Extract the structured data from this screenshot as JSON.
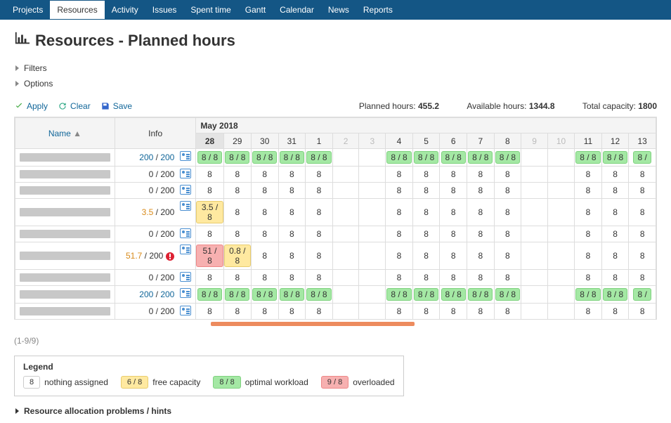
{
  "nav": {
    "items": [
      {
        "label": "Projects",
        "active": false
      },
      {
        "label": "Resources",
        "active": true
      },
      {
        "label": "Activity",
        "active": false
      },
      {
        "label": "Issues",
        "active": false
      },
      {
        "label": "Spent time",
        "active": false
      },
      {
        "label": "Gantt",
        "active": false
      },
      {
        "label": "Calendar",
        "active": false
      },
      {
        "label": "News",
        "active": false
      },
      {
        "label": "Reports",
        "active": false
      }
    ]
  },
  "page": {
    "title": "Resources - Planned hours",
    "filters_label": "Filters",
    "options_label": "Options"
  },
  "actions": {
    "apply": "Apply",
    "clear": "Clear",
    "save": "Save"
  },
  "summary": {
    "planned_label": "Planned hours:",
    "planned_value": "455.2",
    "available_label": "Available hours:",
    "available_value": "1344.8",
    "capacity_label": "Total capacity:",
    "capacity_value": "1800"
  },
  "table": {
    "headers": {
      "name": "Name",
      "info": "Info"
    },
    "month": "May 2018",
    "days": [
      {
        "n": "28",
        "today": true,
        "weekend": false
      },
      {
        "n": "29",
        "today": false,
        "weekend": false
      },
      {
        "n": "30",
        "today": false,
        "weekend": false
      },
      {
        "n": "31",
        "today": false,
        "weekend": false
      },
      {
        "n": "1",
        "today": false,
        "weekend": false
      },
      {
        "n": "2",
        "today": false,
        "weekend": true
      },
      {
        "n": "3",
        "today": false,
        "weekend": true
      },
      {
        "n": "4",
        "today": false,
        "weekend": false
      },
      {
        "n": "5",
        "today": false,
        "weekend": false
      },
      {
        "n": "6",
        "today": false,
        "weekend": false
      },
      {
        "n": "7",
        "today": false,
        "weekend": false
      },
      {
        "n": "8",
        "today": false,
        "weekend": false
      },
      {
        "n": "9",
        "today": false,
        "weekend": true
      },
      {
        "n": "10",
        "today": false,
        "weekend": true
      },
      {
        "n": "11",
        "today": false,
        "weekend": false
      },
      {
        "n": "12",
        "today": false,
        "weekend": false
      },
      {
        "n": "13",
        "today": false,
        "weekend": false
      }
    ],
    "rows": [
      {
        "info_html": [
          "200",
          " / ",
          "200"
        ],
        "info_style": "blue",
        "over": false,
        "cells": [
          "8 / 8",
          "8 / 8",
          "8 / 8",
          "8 / 8",
          "8 / 8",
          "",
          "",
          "8 / 8",
          "8 / 8",
          "8 / 8",
          "8 / 8",
          "8 / 8",
          "",
          "",
          "8 / 8",
          "8 / 8",
          "8 /"
        ],
        "types": [
          "opt",
          "opt",
          "opt",
          "opt",
          "opt",
          "",
          "",
          "opt",
          "opt",
          "opt",
          "opt",
          "opt",
          "",
          "",
          "opt",
          "opt",
          "opt"
        ]
      },
      {
        "info_html": [
          "0 / 200"
        ],
        "info_style": "",
        "over": false,
        "cells": [
          "8",
          "8",
          "8",
          "8",
          "8",
          "",
          "",
          "8",
          "8",
          "8",
          "8",
          "8",
          "",
          "",
          "8",
          "8",
          "8"
        ],
        "types": [
          "none",
          "none",
          "none",
          "none",
          "none",
          "",
          "",
          "none",
          "none",
          "none",
          "none",
          "none",
          "",
          "",
          "none",
          "none",
          "none"
        ]
      },
      {
        "info_html": [
          "0 / 200"
        ],
        "info_style": "",
        "over": false,
        "cells": [
          "8",
          "8",
          "8",
          "8",
          "8",
          "",
          "",
          "8",
          "8",
          "8",
          "8",
          "8",
          "",
          "",
          "8",
          "8",
          "8"
        ],
        "types": [
          "none",
          "none",
          "none",
          "none",
          "none",
          "",
          "",
          "none",
          "none",
          "none",
          "none",
          "none",
          "",
          "",
          "none",
          "none",
          "none"
        ]
      },
      {
        "info_html": [
          "3.5",
          " / 200"
        ],
        "info_style": "orange",
        "over": false,
        "cells": [
          "3.5 / 8",
          "8",
          "8",
          "8",
          "8",
          "",
          "",
          "8",
          "8",
          "8",
          "8",
          "8",
          "",
          "",
          "8",
          "8",
          "8"
        ],
        "types": [
          "free",
          "none",
          "none",
          "none",
          "none",
          "",
          "",
          "none",
          "none",
          "none",
          "none",
          "none",
          "",
          "",
          "none",
          "none",
          "none"
        ]
      },
      {
        "info_html": [
          "0 / 200"
        ],
        "info_style": "",
        "over": false,
        "cells": [
          "8",
          "8",
          "8",
          "8",
          "8",
          "",
          "",
          "8",
          "8",
          "8",
          "8",
          "8",
          "",
          "",
          "8",
          "8",
          "8"
        ],
        "types": [
          "none",
          "none",
          "none",
          "none",
          "none",
          "",
          "",
          "none",
          "none",
          "none",
          "none",
          "none",
          "",
          "",
          "none",
          "none",
          "none"
        ]
      },
      {
        "info_html": [
          "51.7",
          " / 200"
        ],
        "info_style": "orange",
        "over": true,
        "cells": [
          "51 / 8",
          "0.8 / 8",
          "8",
          "8",
          "8",
          "",
          "",
          "8",
          "8",
          "8",
          "8",
          "8",
          "",
          "",
          "8",
          "8",
          "8"
        ],
        "types": [
          "over",
          "free",
          "none",
          "none",
          "none",
          "",
          "",
          "none",
          "none",
          "none",
          "none",
          "none",
          "",
          "",
          "none",
          "none",
          "none"
        ]
      },
      {
        "info_html": [
          "0 / 200"
        ],
        "info_style": "",
        "over": false,
        "cells": [
          "8",
          "8",
          "8",
          "8",
          "8",
          "",
          "",
          "8",
          "8",
          "8",
          "8",
          "8",
          "",
          "",
          "8",
          "8",
          "8"
        ],
        "types": [
          "none",
          "none",
          "none",
          "none",
          "none",
          "",
          "",
          "none",
          "none",
          "none",
          "none",
          "none",
          "",
          "",
          "none",
          "none",
          "none"
        ]
      },
      {
        "info_html": [
          "200",
          " / ",
          "200"
        ],
        "info_style": "blue",
        "over": false,
        "cells": [
          "8 / 8",
          "8 / 8",
          "8 / 8",
          "8 / 8",
          "8 / 8",
          "",
          "",
          "8 / 8",
          "8 / 8",
          "8 / 8",
          "8 / 8",
          "8 / 8",
          "",
          "",
          "8 / 8",
          "8 / 8",
          "8 /"
        ],
        "types": [
          "opt",
          "opt",
          "opt",
          "opt",
          "opt",
          "",
          "",
          "opt",
          "opt",
          "opt",
          "opt",
          "opt",
          "",
          "",
          "opt",
          "opt",
          "opt"
        ]
      },
      {
        "info_html": [
          "0 / 200"
        ],
        "info_style": "",
        "over": false,
        "cells": [
          "8",
          "8",
          "8",
          "8",
          "8",
          "",
          "",
          "8",
          "8",
          "8",
          "8",
          "8",
          "",
          "",
          "8",
          "8",
          "8"
        ],
        "types": [
          "none",
          "none",
          "none",
          "none",
          "none",
          "",
          "",
          "none",
          "none",
          "none",
          "none",
          "none",
          "",
          "",
          "none",
          "none",
          "none"
        ]
      }
    ]
  },
  "pager": "(1-9/9)",
  "legend": {
    "title": "Legend",
    "items": [
      {
        "swatch": "8",
        "cls": "none",
        "label": "nothing assigned"
      },
      {
        "swatch": "6 / 8",
        "cls": "free",
        "label": "free capacity"
      },
      {
        "swatch": "8 / 8",
        "cls": "opt",
        "label": "optimal workload"
      },
      {
        "swatch": "9 / 8",
        "cls": "over",
        "label": "overloaded"
      }
    ]
  },
  "hints_label": "Resource allocation problems / hints"
}
